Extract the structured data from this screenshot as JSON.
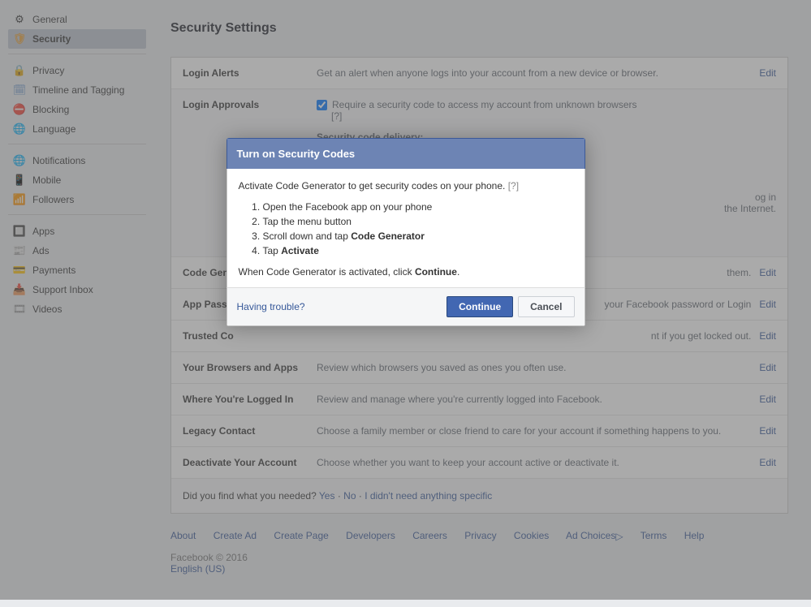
{
  "sidebar": {
    "sections": [
      {
        "items": [
          {
            "icon": "⚙",
            "label": "General"
          },
          {
            "icon": "🛡",
            "label": "Security",
            "active": true
          }
        ]
      },
      {
        "items": [
          {
            "icon": "🔒",
            "label": "Privacy"
          },
          {
            "icon": "🗓",
            "label": "Timeline and Tagging"
          },
          {
            "icon": "⛔",
            "label": "Blocking"
          },
          {
            "icon": "🌐",
            "label": "Language"
          }
        ]
      },
      {
        "items": [
          {
            "icon": "🌐",
            "label": "Notifications"
          },
          {
            "icon": "📱",
            "label": "Mobile"
          },
          {
            "icon": "📶",
            "label": "Followers"
          }
        ]
      },
      {
        "items": [
          {
            "icon": "🔲",
            "label": "Apps"
          },
          {
            "icon": "📰",
            "label": "Ads"
          },
          {
            "icon": "💳",
            "label": "Payments"
          },
          {
            "icon": "📥",
            "label": "Support Inbox"
          },
          {
            "icon": "🎞",
            "label": "Videos"
          }
        ]
      }
    ]
  },
  "page": {
    "title": "Security Settings"
  },
  "settings": {
    "login_alerts": {
      "label": "Login Alerts",
      "desc": "Get an alert when anyone logs into your account from a new device or browser.",
      "edit": "Edit"
    },
    "login_approvals": {
      "label": "Login Approvals",
      "checkbox_label": "Require a security code to access my account from unknown browsers",
      "help": "[?]",
      "delivery_heading": "Security code delivery:",
      "partial1": "og in",
      "partial2": "the Internet."
    },
    "code_gen": {
      "label": "Code Gene",
      "desc_suffix": "them.",
      "edit": "Edit"
    },
    "app_pw": {
      "label": "App Passw",
      "desc_suffix": "your Facebook password or Login",
      "edit": "Edit"
    },
    "trusted": {
      "label": "Trusted Co",
      "desc_suffix": "nt if you get locked out.",
      "edit": "Edit"
    },
    "browsers": {
      "label": "Your Browsers and Apps",
      "desc": "Review which browsers you saved as ones you often use.",
      "edit": "Edit"
    },
    "logged_in": {
      "label": "Where You're Logged In",
      "desc": "Review and manage where you're currently logged into Facebook.",
      "edit": "Edit"
    },
    "legacy": {
      "label": "Legacy Contact",
      "desc": "Choose a family member or close friend to care for your account if something happens to you.",
      "edit": "Edit"
    },
    "deactivate": {
      "label": "Deactivate Your Account",
      "desc": "Choose whether you want to keep your account active or deactivate it.",
      "edit": "Edit"
    }
  },
  "feedback": {
    "question": "Did you find what you needed?  ",
    "yes": "Yes",
    "sep": " · ",
    "no": "No",
    "none": "I didn't need anything specific"
  },
  "footer": {
    "links": [
      "About",
      "Create Ad",
      "Create Page",
      "Developers",
      "Careers",
      "Privacy",
      "Cookies",
      "Ad Choices",
      "Terms",
      "Help"
    ],
    "copyright": "Facebook © 2016",
    "locale": "English (US)"
  },
  "modal": {
    "title": "Turn on Security Codes",
    "intro": "Activate Code Generator to get security codes on your phone.",
    "help": "[?]",
    "steps": [
      "Open the Facebook app on your phone",
      "Tap the menu button",
      "Scroll down and tap ",
      "Tap "
    ],
    "step3_bold": "Code Generator",
    "step4_bold": "Activate",
    "outro_prefix": "When Code Generator is activated, click ",
    "outro_bold": "Continue",
    "outro_suffix": ".",
    "trouble": "Having trouble?",
    "continue": "Continue",
    "cancel": "Cancel"
  }
}
